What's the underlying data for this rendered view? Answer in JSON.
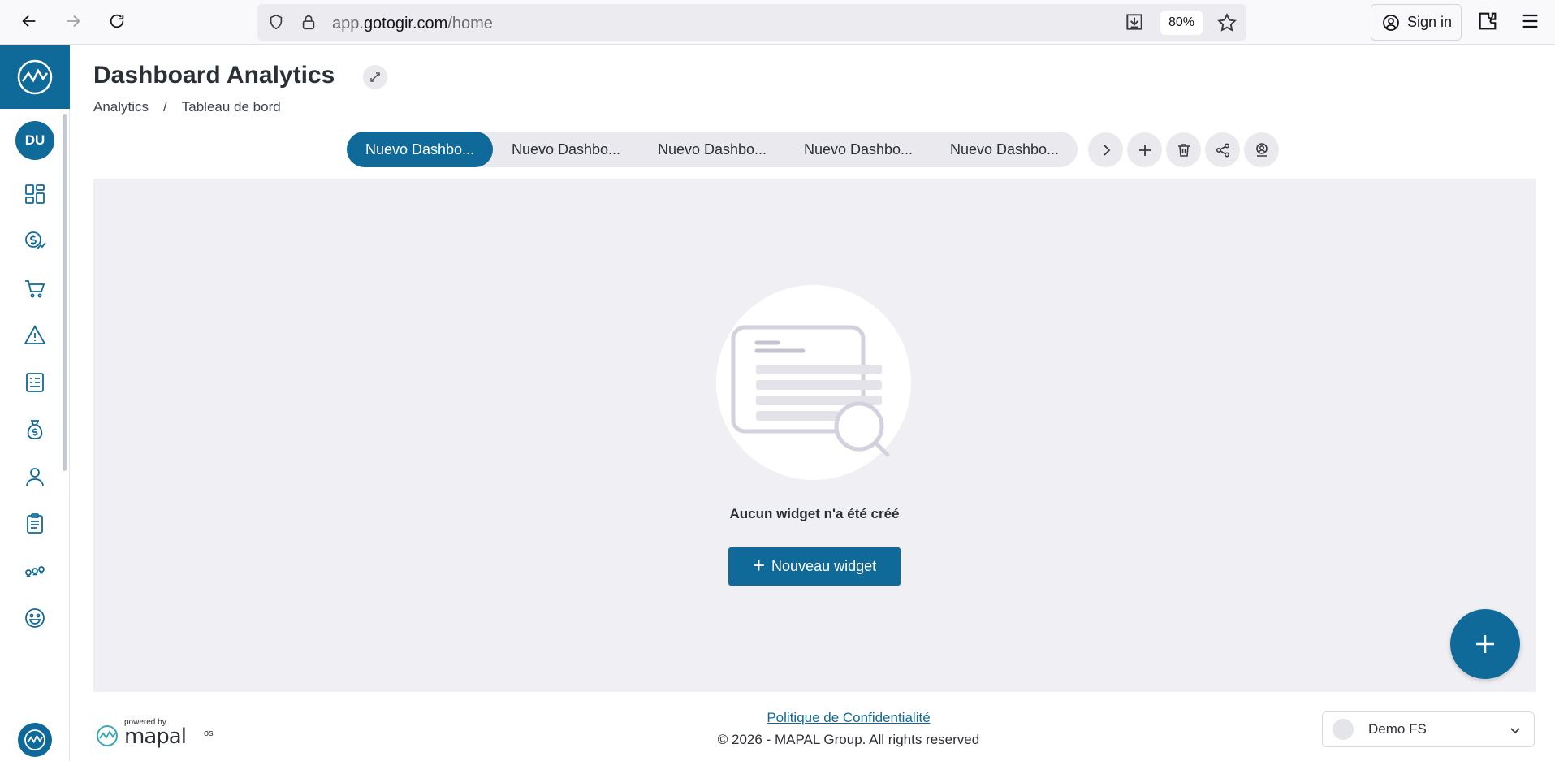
{
  "browser": {
    "url_prefix": "app.",
    "url_domain": "gotogir.com",
    "url_path": "/home",
    "zoom": "80%",
    "sign_in": "Sign in"
  },
  "sidebar": {
    "avatar_initials": "DU",
    "items": [
      {
        "icon": "dashboard-icon"
      },
      {
        "icon": "sales-icon"
      },
      {
        "icon": "cart-icon"
      },
      {
        "icon": "alert-icon"
      },
      {
        "icon": "report-icon"
      },
      {
        "icon": "money-bag-icon"
      },
      {
        "icon": "user-icon"
      },
      {
        "icon": "clipboard-icon"
      },
      {
        "icon": "connections-icon"
      },
      {
        "icon": "smiley-icon"
      }
    ]
  },
  "header": {
    "title": "Dashboard Analytics",
    "breadcrumb": [
      "Analytics",
      "Tableau de bord"
    ],
    "breadcrumb_sep": "/"
  },
  "tabs": [
    {
      "label": "Nuevo Dashbo...",
      "active": true
    },
    {
      "label": "Nuevo Dashbo...",
      "active": false
    },
    {
      "label": "Nuevo Dashbo...",
      "active": false
    },
    {
      "label": "Nuevo Dashbo...",
      "active": false
    },
    {
      "label": "Nuevo Dashbo...",
      "active": false
    }
  ],
  "main": {
    "empty_message": "Aucun widget n'a été créé",
    "new_widget_label": "Nouveau widget"
  },
  "footer": {
    "powered_by": "powered by",
    "brand": "mapal",
    "brand_suffix": "os",
    "policy_link": "Politique de Confidentialité",
    "copyright": "© 2026 - MAPAL Group. All rights reserved",
    "venue": "Demo FS"
  },
  "colors": {
    "accent": "#0f6a99",
    "canvas_bg": "#f0f0f4",
    "tab_bg": "#e9e9ee"
  }
}
